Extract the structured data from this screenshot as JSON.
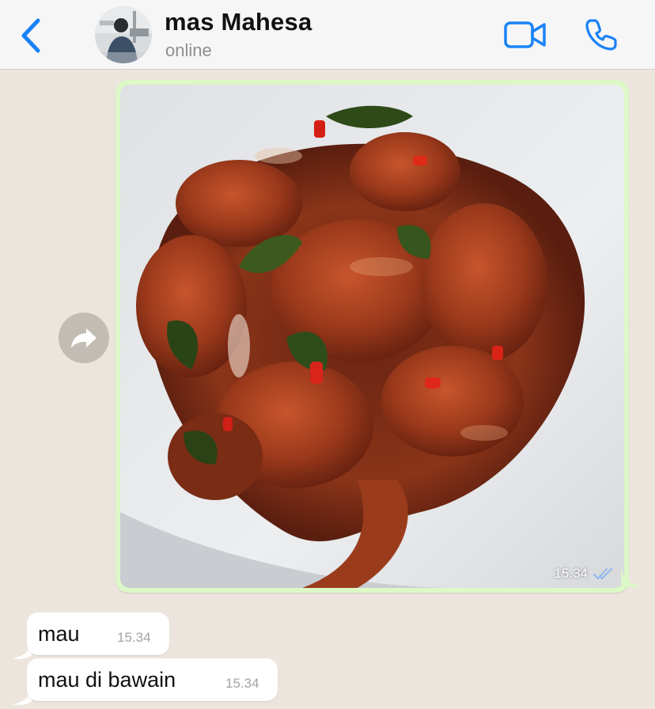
{
  "header": {
    "back_icon": "chevron-left-icon",
    "contact_name": "mas Mahesa",
    "status": "online",
    "video_icon": "video-camera-icon",
    "call_icon": "phone-icon",
    "accent_color": "#1a82f7"
  },
  "messages": [
    {
      "type": "image",
      "direction": "outgoing",
      "time": "15.34",
      "status_icon": "double-check-icon",
      "bubble_color": "#dcf8c6"
    },
    {
      "type": "text",
      "direction": "incoming",
      "text": "mau",
      "time": "15.34"
    },
    {
      "type": "text",
      "direction": "incoming",
      "text": "mau di bawain",
      "time": "15.34"
    }
  ],
  "forward_icon": "forward-arrow-icon",
  "chat_background": "#ece5dd"
}
